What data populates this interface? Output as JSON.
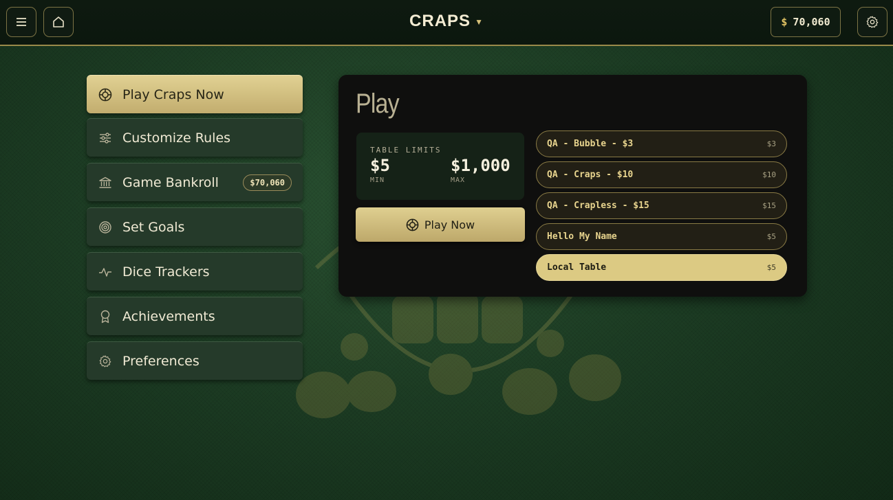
{
  "header": {
    "title": "CRAPS",
    "balance_symbol": "$",
    "balance": "70,060"
  },
  "icons": {
    "menu": "hamburger-icon",
    "home": "home-icon",
    "title_dropdown": "chevron-down-icon",
    "settings": "gear-icon"
  },
  "sidebar": {
    "items": [
      {
        "label": "Play Craps Now",
        "icon": "poker-chip-icon",
        "active": true
      },
      {
        "label": "Customize Rules",
        "icon": "sliders-icon"
      },
      {
        "label": "Game Bankroll",
        "icon": "bank-icon",
        "badge": "$70,060"
      },
      {
        "label": "Set Goals",
        "icon": "target-icon"
      },
      {
        "label": "Dice Trackers",
        "icon": "pulse-icon"
      },
      {
        "label": "Achievements",
        "icon": "award-icon"
      },
      {
        "label": "Preferences",
        "icon": "gear-icon"
      }
    ]
  },
  "play": {
    "title": "Play",
    "limits_label": "TABLE LIMITS",
    "min_value": "$5",
    "min_label": "MIN",
    "max_value": "$1,000",
    "max_label": "MAX",
    "play_button": "Play Now"
  },
  "tables": [
    {
      "name": "QA - Bubble - $3",
      "min": "$3"
    },
    {
      "name": "QA - Craps - $10",
      "min": "$10"
    },
    {
      "name": "QA - Crapless - $15",
      "min": "$15"
    },
    {
      "name": "Hello My Name",
      "min": "$5"
    },
    {
      "name": "Local Table",
      "min": "$5",
      "selected": true
    }
  ],
  "colors": {
    "accent_gold": "#dcca83",
    "panel_bg": "#0f0f0e",
    "menu_bg": "#253a2a"
  }
}
